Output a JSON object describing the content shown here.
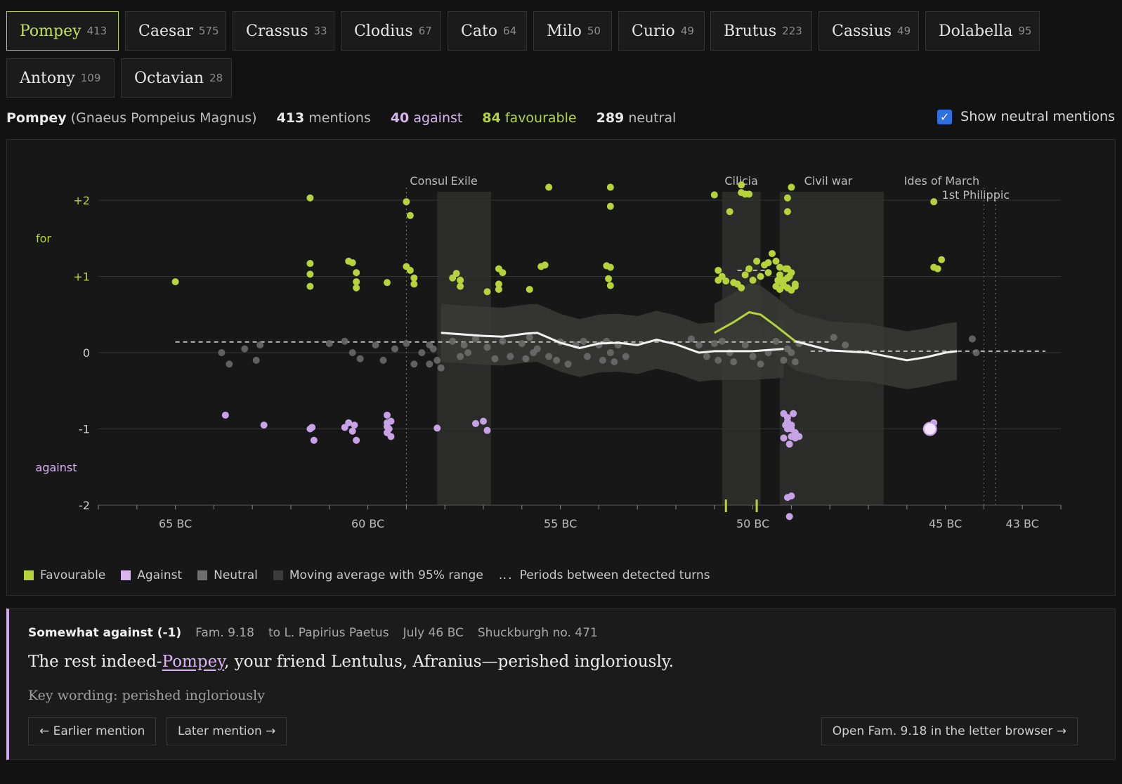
{
  "tabs": [
    {
      "name": "Pompey",
      "count": "413"
    },
    {
      "name": "Caesar",
      "count": "575"
    },
    {
      "name": "Crassus",
      "count": "33"
    },
    {
      "name": "Clodius",
      "count": "67"
    },
    {
      "name": "Cato",
      "count": "64"
    },
    {
      "name": "Milo",
      "count": "50"
    },
    {
      "name": "Curio",
      "count": "49"
    },
    {
      "name": "Brutus",
      "count": "223"
    },
    {
      "name": "Cassius",
      "count": "49"
    },
    {
      "name": "Dolabella",
      "count": "95"
    },
    {
      "name": "Antony",
      "count": "109"
    },
    {
      "name": "Octavian",
      "count": "28"
    }
  ],
  "summary": {
    "name": "Pompey",
    "fullname": "(Gnaeus Pompeius Magnus)",
    "mentions_n": "413",
    "mentions_label": "mentions",
    "against_n": "40",
    "against_label": "against",
    "favourable_n": "84",
    "favourable_label": "favourable",
    "neutral_n": "289",
    "neutral_label": "neutral"
  },
  "neutral_toggle": {
    "label": "Show neutral mentions",
    "checked": true
  },
  "colors": {
    "favourable": "#b6d33c",
    "against": "#d9b6f2",
    "neutral": "#6e6e6e",
    "band": "#3a3a36",
    "background": "#121212"
  },
  "chart_data": {
    "type": "scatter",
    "y_ticks": [
      "+2",
      "+1",
      "0",
      "-1",
      "-2"
    ],
    "ylim": [
      -2,
      2
    ],
    "y_side_labels": {
      "for": "for",
      "against": "against"
    },
    "x_ticks": [
      "65 BC",
      "60 BC",
      "55 BC",
      "50 BC",
      "45 BC",
      "43 BC"
    ],
    "xlim": [
      67,
      42
    ],
    "events": [
      {
        "label": "Consul",
        "year": 59
      },
      {
        "label": "Ides of March",
        "year": 44
      },
      {
        "label": "1st Philippic",
        "year": 43.7
      }
    ],
    "periods": [
      {
        "label": "Exile",
        "start": 58.2,
        "end": 56.8
      },
      {
        "label": "Cilicia",
        "start": 50.8,
        "end": 49.8
      },
      {
        "label": "Civil war",
        "start": 49.3,
        "end": 46.6
      }
    ],
    "favourable": [
      [
        65.0,
        0.93
      ],
      [
        61.5,
        2.03
      ],
      [
        61.5,
        1.17
      ],
      [
        61.5,
        1.03
      ],
      [
        61.5,
        0.87
      ],
      [
        60.5,
        1.2
      ],
      [
        60.4,
        1.18
      ],
      [
        60.3,
        1.05
      ],
      [
        60.3,
        0.93
      ],
      [
        60.3,
        0.85
      ],
      [
        59.5,
        0.92
      ],
      [
        59,
        1.98
      ],
      [
        58.9,
        1.8
      ],
      [
        59,
        1.13
      ],
      [
        58.9,
        1.08
      ],
      [
        58.8,
        0.98
      ],
      [
        58.8,
        0.9
      ],
      [
        57.8,
        0.98
      ],
      [
        57.7,
        1.04
      ],
      [
        57.6,
        0.87
      ],
      [
        57.6,
        0.95
      ],
      [
        56.9,
        0.8
      ],
      [
        56.6,
        1.1
      ],
      [
        56.6,
        0.9
      ],
      [
        56.5,
        1.05
      ],
      [
        56.6,
        0.83
      ],
      [
        55.8,
        0.83
      ],
      [
        55.5,
        1.13
      ],
      [
        55.4,
        1.15
      ],
      [
        55.3,
        2.17
      ],
      [
        53.7,
        2.17
      ],
      [
        53.7,
        1.92
      ],
      [
        53.8,
        1.14
      ],
      [
        53.7,
        1.12
      ],
      [
        53.7,
        0.88
      ],
      [
        51.0,
        2.07
      ],
      [
        50.6,
        1.85
      ],
      [
        50.3,
        2.2
      ],
      [
        50.3,
        2.1
      ],
      [
        50.2,
        2.08
      ],
      [
        50.1,
        2.08
      ],
      [
        50.9,
        1.08
      ],
      [
        50.7,
        0.94
      ],
      [
        50.8,
        1.0
      ],
      [
        50.5,
        0.92
      ],
      [
        50.3,
        0.85
      ],
      [
        50.1,
        1.1
      ],
      [
        50.2,
        1.02
      ],
      [
        49.9,
        1.2
      ],
      [
        49.6,
        1.05
      ],
      [
        49.4,
        0.87
      ],
      [
        49.3,
        1.12
      ],
      [
        49.3,
        1.02
      ],
      [
        49.2,
        0.88
      ],
      [
        49.1,
        1.1
      ],
      [
        49.1,
        0.98
      ],
      [
        49.0,
        1.05
      ],
      [
        48.9,
        0.9
      ],
      [
        49.5,
        1.3
      ],
      [
        49.0,
        2.17
      ],
      [
        49.1,
        2.03
      ],
      [
        49.1,
        1.85
      ],
      [
        49.2,
        0.95
      ],
      [
        49.1,
        0.85
      ],
      [
        49.0,
        0.82
      ],
      [
        48.9,
        0.87
      ],
      [
        49.15,
        1.1
      ],
      [
        49.25,
        0.92
      ],
      [
        49.05,
        1.0
      ],
      [
        45.3,
        1.98
      ],
      [
        45.3,
        1.12
      ],
      [
        45.2,
        1.1
      ],
      [
        45.1,
        1.22
      ],
      [
        50.9,
        0.95
      ],
      [
        50.0,
        0.95
      ],
      [
        49.6,
        1.18
      ],
      [
        49.7,
        1.15
      ],
      [
        49.8,
        1.0
      ],
      [
        49.4,
        1.2
      ],
      [
        49.35,
        0.95
      ],
      [
        49.3,
        0.83
      ],
      [
        50.4,
        0.9
      ],
      [
        53.75,
        0.97
      ]
    ],
    "against": [
      [
        63.7,
        -0.82
      ],
      [
        62.7,
        -0.95
      ],
      [
        61.5,
        -1.0
      ],
      [
        61.4,
        -1.15
      ],
      [
        60.6,
        -0.98
      ],
      [
        60.5,
        -0.92
      ],
      [
        60.4,
        -1.03
      ],
      [
        60.3,
        -1.15
      ],
      [
        59.5,
        -0.82
      ],
      [
        59.5,
        -0.92
      ],
      [
        59.5,
        -0.97
      ],
      [
        59.5,
        -1.05
      ],
      [
        59.4,
        -0.9
      ],
      [
        59.4,
        -1.1
      ],
      [
        58.2,
        -0.99
      ],
      [
        57.2,
        -0.93
      ],
      [
        57.0,
        -0.9
      ],
      [
        56.9,
        -1.02
      ],
      [
        49.2,
        -0.8
      ],
      [
        49.1,
        -0.85
      ],
      [
        49.1,
        -0.9
      ],
      [
        49.0,
        -0.95
      ],
      [
        49.0,
        -1.0
      ],
      [
        48.9,
        -1.05
      ],
      [
        48.9,
        -1.12
      ],
      [
        49.2,
        -1.12
      ],
      [
        49.05,
        -1.2
      ],
      [
        49.1,
        -1.9
      ],
      [
        49.0,
        -1.88
      ],
      [
        49.05,
        -2.15
      ],
      [
        48.8,
        -1.1
      ],
      [
        45.4,
        -1.0
      ],
      [
        45.3,
        -0.92
      ],
      [
        49.1,
        -1.0
      ],
      [
        49.0,
        -1.1
      ],
      [
        48.95,
        -0.8
      ],
      [
        49.15,
        -0.95
      ],
      [
        59.45,
        -1.0
      ],
      [
        60.35,
        -0.95
      ],
      [
        61.45,
        -0.98
      ]
    ],
    "neutral_count": "289",
    "moving_average": [
      [
        58.1,
        0.26
      ],
      [
        57.0,
        0.22
      ],
      [
        56.5,
        0.21
      ],
      [
        55.9,
        0.25
      ],
      [
        55.6,
        0.26
      ],
      [
        55.0,
        0.13
      ],
      [
        54.5,
        0.06
      ],
      [
        54.0,
        0.12
      ],
      [
        53.5,
        0.13
      ],
      [
        53.0,
        0.1
      ],
      [
        52.5,
        0.17
      ],
      [
        52.0,
        0.11
      ],
      [
        51.4,
        0.0
      ],
      [
        51.0,
        0.02
      ],
      [
        50.5,
        0.02
      ],
      [
        50.0,
        0.02
      ],
      [
        49.2,
        0.05
      ]
    ],
    "moving_average_b": [
      [
        51.0,
        0.26
      ],
      [
        50.5,
        0.4
      ],
      [
        50.1,
        0.53
      ],
      [
        49.8,
        0.5
      ],
      [
        49.4,
        0.35
      ],
      [
        48.9,
        0.15
      ],
      [
        48.0,
        0.03
      ],
      [
        47.0,
        0.0
      ],
      [
        46.5,
        -0.05
      ],
      [
        46.0,
        -0.1
      ],
      [
        45.5,
        -0.06
      ],
      [
        45.0,
        0.0
      ],
      [
        44.7,
        0.02
      ]
    ],
    "neutral_points": [
      [
        58.4,
        0.1
      ],
      [
        58.4,
        -0.15
      ],
      [
        58.3,
        0.05
      ],
      [
        58.2,
        -0.1
      ],
      [
        58.1,
        -0.2
      ],
      [
        57.8,
        0.15
      ],
      [
        57.6,
        -0.05
      ],
      [
        57.5,
        0.1
      ],
      [
        57.4,
        0.0
      ],
      [
        57.2,
        0.18
      ],
      [
        56.9,
        0.07
      ],
      [
        56.7,
        -0.08
      ],
      [
        56.5,
        0.15
      ],
      [
        56.3,
        -0.05
      ],
      [
        56.0,
        0.12
      ],
      [
        55.9,
        -0.08
      ],
      [
        55.8,
        0.2
      ],
      [
        55.7,
        0.0
      ],
      [
        55.6,
        0.05
      ],
      [
        55.3,
        -0.05
      ],
      [
        55.1,
        -0.1
      ],
      [
        55.0,
        0.14
      ],
      [
        54.8,
        -0.15
      ],
      [
        54.6,
        0.1
      ],
      [
        54.4,
        0.15
      ],
      [
        54.3,
        -0.05
      ],
      [
        54.0,
        0.1
      ],
      [
        53.9,
        -0.1
      ],
      [
        53.8,
        0.15
      ],
      [
        53.7,
        0.0
      ],
      [
        53.6,
        -0.12
      ],
      [
        53.5,
        0.1
      ],
      [
        53.3,
        -0.05
      ],
      [
        51.6,
        0.18
      ],
      [
        51.4,
        0.1
      ],
      [
        51.2,
        -0.05
      ],
      [
        51.0,
        0.12
      ],
      [
        50.9,
        -0.1
      ],
      [
        50.8,
        0.15
      ],
      [
        50.6,
        0.0
      ],
      [
        50.5,
        -0.12
      ],
      [
        50.2,
        0.1
      ],
      [
        50.0,
        -0.05
      ],
      [
        49.8,
        -0.15
      ],
      [
        49.6,
        0.0
      ],
      [
        49.4,
        0.15
      ],
      [
        49.2,
        -0.1
      ],
      [
        49.1,
        0.05
      ],
      [
        49.0,
        0.0
      ],
      [
        48.9,
        -0.12
      ],
      [
        48.8,
        0.12
      ],
      [
        47.9,
        0.2
      ],
      [
        47.6,
        0.1
      ],
      [
        44.3,
        0.18
      ],
      [
        44.2,
        0.0
      ],
      [
        62.8,
        0.1
      ],
      [
        62.9,
        -0.1
      ],
      [
        63.2,
        0.05
      ],
      [
        63.8,
        0.0
      ],
      [
        63.6,
        -0.15
      ],
      [
        61.0,
        0.12
      ],
      [
        60.6,
        0.15
      ],
      [
        60.4,
        0.0
      ],
      [
        60.2,
        -0.08
      ],
      [
        59.8,
        0.1
      ],
      [
        59.6,
        -0.1
      ],
      [
        59.3,
        0.05
      ],
      [
        59.0,
        0.12
      ],
      [
        58.8,
        -0.15
      ],
      [
        58.6,
        0.0
      ]
    ],
    "turn_marks": [
      50.7,
      49.9
    ]
  },
  "legend": {
    "favourable": "Favourable",
    "against": "Against",
    "neutral": "Neutral",
    "moving_avg": "Moving average with 95% range",
    "periods": "Periods between detected turns"
  },
  "detail": {
    "stance": "Somewhat against (-1)",
    "ref": "Fam. 9.18",
    "recipient": "to L. Papirius Paetus",
    "date": "July 46 BC",
    "shuckburgh": "Shuckburgh no. 471",
    "quote_before": "The rest indeed-",
    "quote_name": "Pompey",
    "quote_after": ", your friend Lentulus, Afranius—perished ingloriously.",
    "key_wording": "Key wording: perished ingloriously"
  },
  "buttons": {
    "earlier": "← Earlier mention",
    "later": "Later mention →",
    "open": "Open Fam. 9.18 in the letter browser →"
  }
}
